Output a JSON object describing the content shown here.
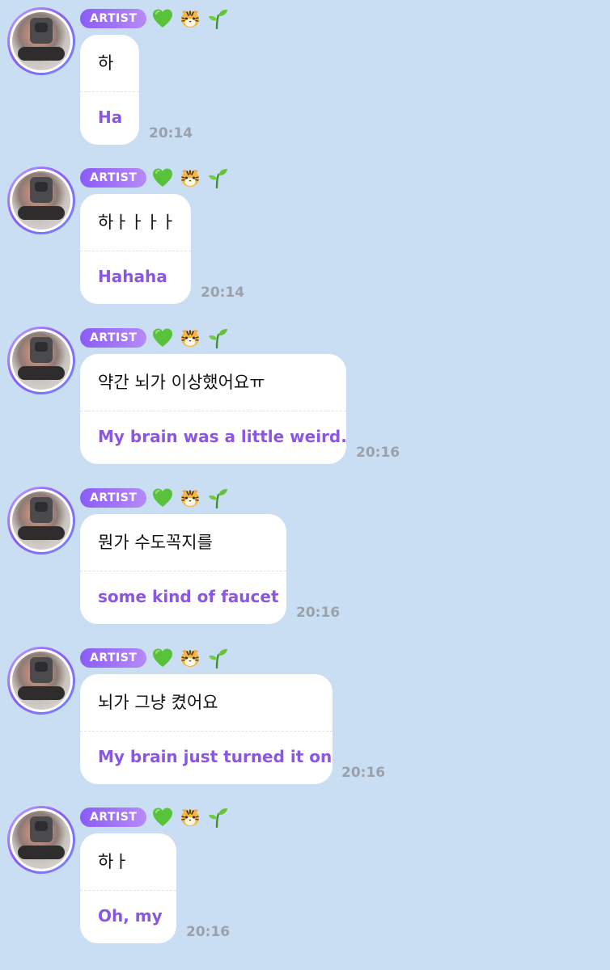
{
  "badge_label": "ARTIST",
  "badge_emojis": [
    "green-heart-icon",
    "tiger-face-icon",
    "seedling-icon"
  ],
  "messages": [
    {
      "original": "하",
      "translation": "Ha",
      "time": "20:14"
    },
    {
      "original": "하ㅏㅏㅏㅏ",
      "translation": "Hahaha",
      "time": "20:14"
    },
    {
      "original": "약간 뇌가 이상했어요ㅠ",
      "translation": "My brain was a little weird.",
      "time": "20:16"
    },
    {
      "original": "뭔가 수도꼭지를",
      "translation": "some kind of faucet",
      "time": "20:16"
    },
    {
      "original": "뇌가 그냥 켰어요",
      "translation": "My brain just turned it on",
      "time": "20:16"
    },
    {
      "original": "하ㅏ",
      "translation": "Oh, my",
      "time": "20:16"
    }
  ],
  "colors": {
    "background": "#cadef3",
    "translation_text": "#8a57e0",
    "badge_start": "#8a5cf6",
    "badge_end": "#b78af8",
    "timestamp": "#9aa1ab"
  }
}
